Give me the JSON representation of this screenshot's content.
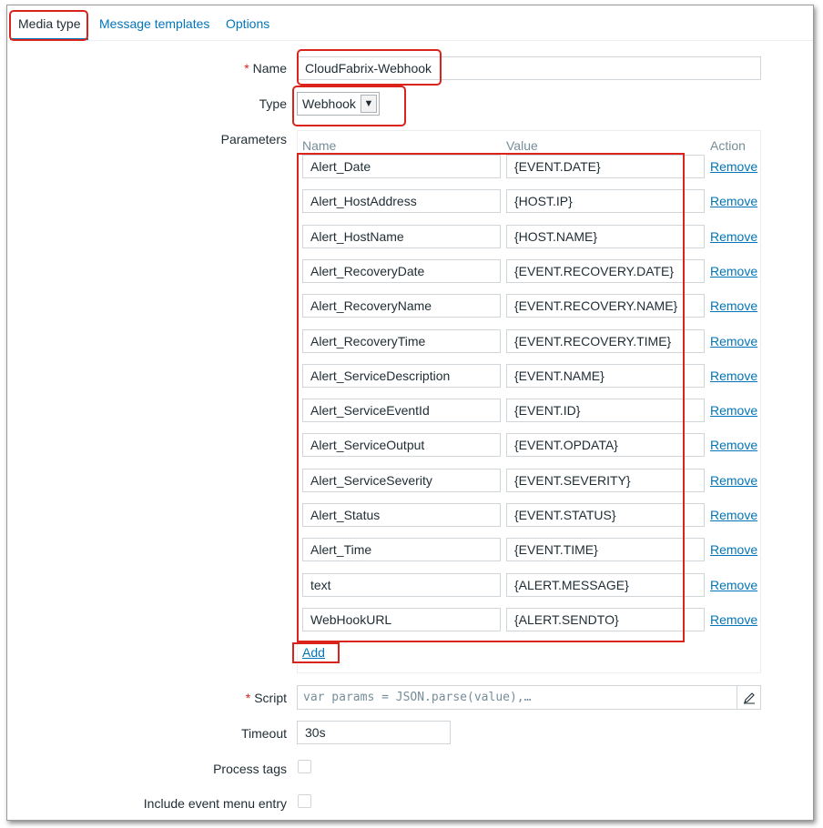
{
  "tabs": [
    {
      "label": "Media type",
      "active": true
    },
    {
      "label": "Message templates",
      "active": false
    },
    {
      "label": "Options",
      "active": false
    }
  ],
  "form": {
    "name_label": "Name",
    "name_value": "CloudFabrix-Webhook",
    "type_label": "Type",
    "type_value": "Webhook",
    "parameters_label": "Parameters",
    "script_label": "Script",
    "script_value": "var params = JSON.parse(value),…",
    "timeout_label": "Timeout",
    "timeout_value": "30s",
    "process_tags_label": "Process tags",
    "include_menu_label": "Include event menu entry",
    "required_mark": "*"
  },
  "parameters": {
    "headers": {
      "name": "Name",
      "value": "Value",
      "action": "Action"
    },
    "remove_label": "Remove",
    "add_label": "Add",
    "rows": [
      {
        "name": "Alert_Date",
        "value": "{EVENT.DATE}"
      },
      {
        "name": "Alert_HostAddress",
        "value": "{HOST.IP}"
      },
      {
        "name": "Alert_HostName",
        "value": "{HOST.NAME}"
      },
      {
        "name": "Alert_RecoveryDate",
        "value": "{EVENT.RECOVERY.DATE}"
      },
      {
        "name": "Alert_RecoveryName",
        "value": "{EVENT.RECOVERY.NAME}"
      },
      {
        "name": "Alert_RecoveryTime",
        "value": "{EVENT.RECOVERY.TIME}"
      },
      {
        "name": "Alert_ServiceDescription",
        "value": "{EVENT.NAME}"
      },
      {
        "name": "Alert_ServiceEventId",
        "value": "{EVENT.ID}"
      },
      {
        "name": "Alert_ServiceOutput",
        "value": "{EVENT.OPDATA}"
      },
      {
        "name": "Alert_ServiceSeverity",
        "value": "{EVENT.SEVERITY}"
      },
      {
        "name": "Alert_Status",
        "value": "{EVENT.STATUS}"
      },
      {
        "name": "Alert_Time",
        "value": "{EVENT.TIME}"
      },
      {
        "name": "text",
        "value": "{ALERT.MESSAGE}"
      },
      {
        "name": "WebHookURL",
        "value": "{ALERT.SENDTO}"
      }
    ]
  },
  "colors": {
    "link": "#0275b8",
    "highlight": "#d9231b",
    "required": "#d9231b"
  }
}
